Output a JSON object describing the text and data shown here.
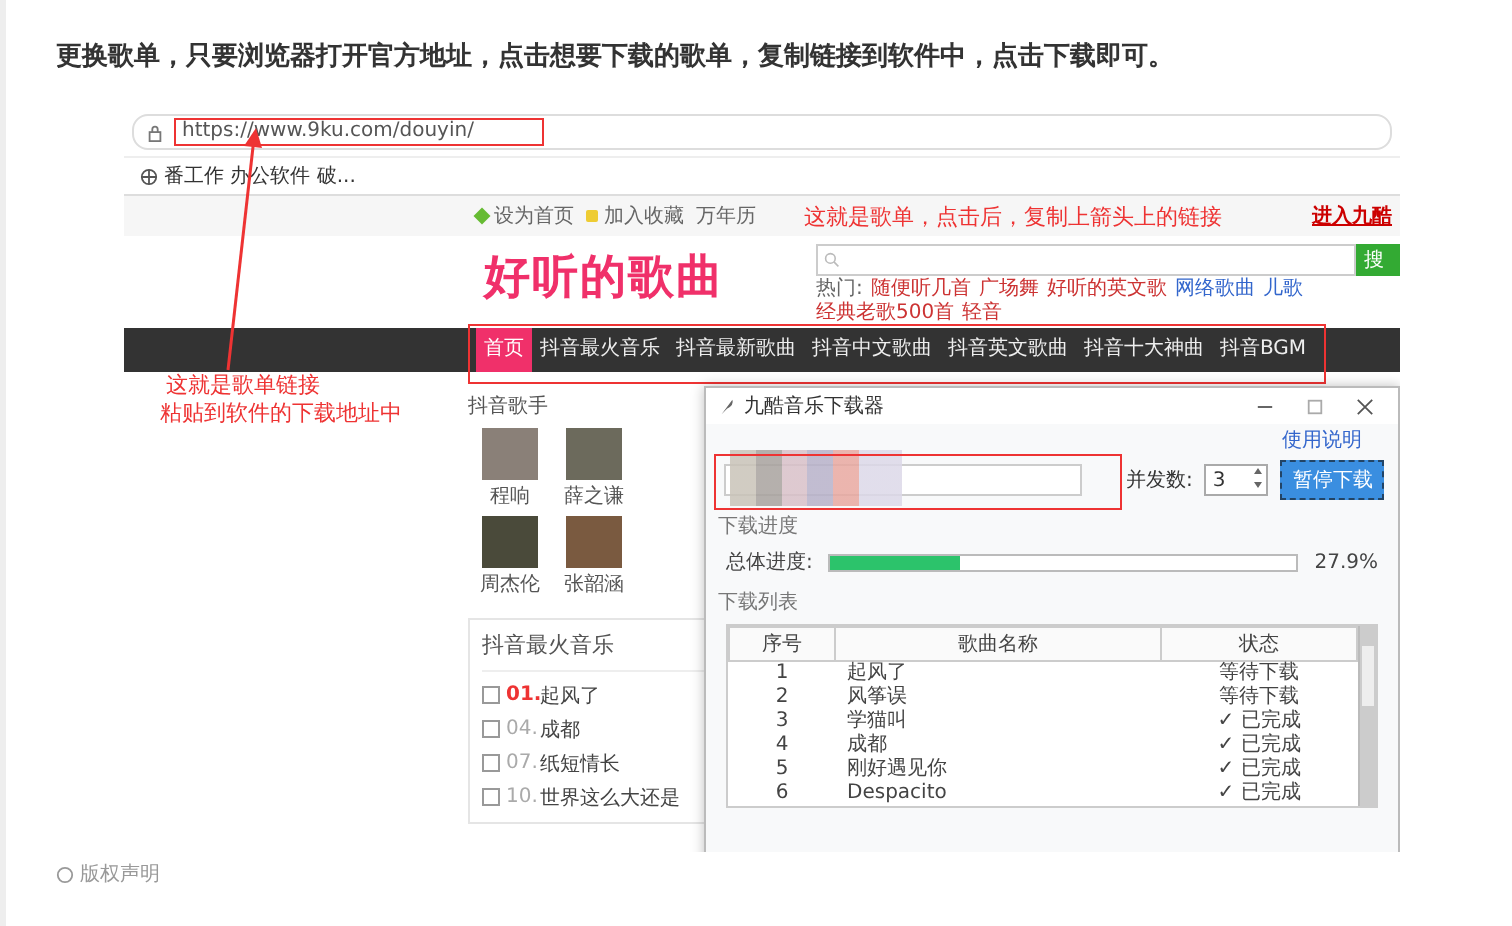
{
  "article": {
    "text": "更换歌单，只要浏览器打开官方地址，点击想要下载的歌单，复制链接到软件中，点击下载即可。"
  },
  "screenshot": {
    "browser": {
      "url": "https://www.9ku.com/douyin/",
      "bookmark": "番工作 办公软件 破..."
    },
    "site": {
      "top_links": [
        "设为首页",
        "加入收藏",
        "万年历"
      ],
      "enter_link": "进入九酷",
      "logo": "好听的歌曲",
      "search_button": "搜",
      "hot_label": "热门:",
      "hot_links": [
        "随便听几首",
        "广场舞",
        "好听的英文歌",
        "网络歌曲",
        "儿歌",
        "经典老歌500首",
        "轻音"
      ],
      "nav": [
        {
          "label": "首页",
          "selected": true
        },
        {
          "label": "抖音最火音乐",
          "selected": false
        },
        {
          "label": "抖音最新歌曲",
          "selected": false
        },
        {
          "label": "抖音中文歌曲",
          "selected": false
        },
        {
          "label": "抖音英文歌曲",
          "selected": false
        },
        {
          "label": "抖音十大神曲",
          "selected": false
        },
        {
          "label": "抖音BGM",
          "selected": false
        }
      ],
      "singers_title": "抖音歌手",
      "singers": [
        "程响",
        "薛之谦",
        "周杰伦",
        "张韶涵"
      ],
      "hot_title": "抖音最火音乐",
      "songs": [
        {
          "number": "01.",
          "title": "起风了",
          "checked": false,
          "top": true
        },
        {
          "number": "04.",
          "title": "成都",
          "checked": false,
          "top": false
        },
        {
          "number": "07.",
          "title": "纸短情长",
          "checked": false,
          "top": false
        },
        {
          "number": "10.",
          "title": "世界这么大还是",
          "checked": false,
          "top": false
        }
      ]
    },
    "annotation_top": "这就是歌单，点击后，复制上箭头上的链接",
    "annotation_left": [
      "这就是歌单链接",
      "粘贴到软件的下载地址中"
    ],
    "downloader": {
      "title": "九酷音乐下载器",
      "help_link": "使用说明",
      "concurrency_label": "并发数:",
      "concurrency": "3",
      "button": "暂停下载",
      "progress_section": "下载进度",
      "progress_label": "总体进度:",
      "level": 0.279,
      "progress_text": "27.9%",
      "list_section": "下载列表",
      "columns": [
        "序号",
        "歌曲名称",
        "状态"
      ],
      "rows": [
        [
          "1",
          "起风了",
          "等待下载"
        ],
        [
          "2",
          "风筝误",
          "等待下载"
        ],
        [
          "3",
          "学猫叫",
          "✓ 已完成"
        ],
        [
          "4",
          "成都",
          "✓ 已完成"
        ],
        [
          "5",
          "刚好遇见你",
          "✓ 已完成"
        ],
        [
          "6",
          "Despacito",
          "✓ 已完成"
        ]
      ]
    }
  },
  "footer": {
    "text": "版权声明"
  }
}
